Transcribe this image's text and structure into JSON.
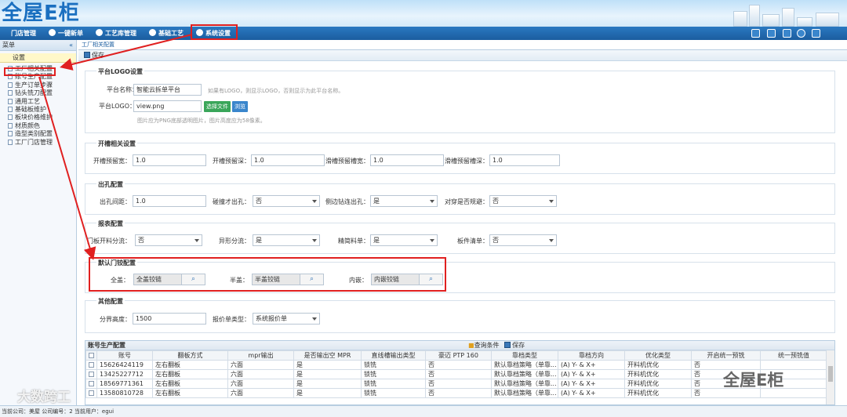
{
  "app": {
    "logo_text": "全屋E柜"
  },
  "nav": {
    "items": [
      {
        "label": "门店管理"
      },
      {
        "label": "一键新单"
      },
      {
        "label": "工艺库管理"
      },
      {
        "label": "基础工艺"
      },
      {
        "label": "系统设置"
      }
    ]
  },
  "sidebar": {
    "header": "菜单",
    "collapse": "«",
    "group": "设置",
    "items": [
      {
        "label": "工厂相关配置"
      },
      {
        "label": "账号生产配置"
      },
      {
        "label": "生产订单步骤"
      },
      {
        "label": "钻头铣刀配置"
      },
      {
        "label": "通用工艺"
      },
      {
        "label": "基础板维护"
      },
      {
        "label": "板块价格维护"
      },
      {
        "label": "材质颜色"
      },
      {
        "label": "造型类别配置"
      },
      {
        "label": "工厂门店管理"
      }
    ]
  },
  "main": {
    "breadcrumb": "工厂相关配置",
    "save_label": "保存",
    "platform": {
      "legend": "平台LOGO设置",
      "name_label": "平台名称：",
      "name_value": "智能云拆单平台",
      "name_hint": "如果有LOGO，则显示LOGO，否则显示为此平台名称。",
      "logo_label": "平台LOGO：",
      "logo_value": "view.png",
      "choose_btn": "选择文件",
      "browse_btn": "浏览",
      "logo_hint": "图片应为PNG底部透明图片，图片高度应为58像素。"
    },
    "slot": {
      "legend": "开槽相关设置",
      "fields": [
        {
          "label": "开槽预留宽：",
          "value": "1.0"
        },
        {
          "label": "开槽预留深：",
          "value": "1.0"
        },
        {
          "label": "滑槽预留槽宽：",
          "value": "1.0"
        },
        {
          "label": "滑槽预留槽深：",
          "value": "1.0"
        }
      ]
    },
    "hole": {
      "legend": "出孔配置",
      "fields": [
        {
          "label": "出孔间距：",
          "value": "1.0"
        },
        {
          "label": "碰撞才出孔：",
          "value": "否"
        },
        {
          "label": "侧边钻连出孔：",
          "value": "是"
        },
        {
          "label": "对穿是否规避：",
          "value": "否"
        }
      ]
    },
    "report": {
      "legend": "报表配置",
      "fields": [
        {
          "label": "门板开料分流：",
          "value": "否"
        },
        {
          "label": "异形分流：",
          "value": "是"
        },
        {
          "label": "精简料单：",
          "value": "是"
        },
        {
          "label": "板件清单：",
          "value": "否"
        }
      ]
    },
    "hinge": {
      "legend": "默认门铰配置",
      "fields": [
        {
          "label": "全盖：",
          "value": "全盖铰链"
        },
        {
          "label": "半盖：",
          "value": "半盖铰链"
        },
        {
          "label": "内嵌：",
          "value": "内嵌铰链"
        }
      ]
    },
    "other": {
      "legend": "其他配置",
      "height_label": "分界高度：",
      "height_value": "1500",
      "quote_label": "报价单类型：",
      "quote_value": "系统报价单"
    },
    "grid": {
      "title": "账号生产配置",
      "query_label": "查询条件",
      "save_label": "保存",
      "columns": [
        "账号",
        "翻板方式",
        "mpr输出",
        "是否输出空 MPR",
        "直线槽输出类型",
        "豪迈 PTP 160",
        "靠档类型",
        "靠档方向",
        "优化类型",
        "开启统一预铣",
        "统一预铣值"
      ],
      "rows": [
        [
          "15626424119",
          "左右翻板",
          "六面",
          "是",
          "锁铣",
          "否",
          "默认靠档策略（单靠...",
          "(A) Y- & X+",
          "开料机优化",
          "否",
          ""
        ],
        [
          "13425227712",
          "左右翻板",
          "六面",
          "是",
          "锁铣",
          "否",
          "默认靠档策略（单靠...",
          "(A) Y- & X+",
          "开料机优化",
          "否",
          ""
        ],
        [
          "18569771361",
          "左右翻板",
          "六面",
          "是",
          "锁铣",
          "否",
          "默认靠档策略（单靠...",
          "(A) Y- & X+",
          "开料机优化",
          "否",
          ""
        ],
        [
          "13580810728",
          "左右翻板",
          "六面",
          "是",
          "锁铣",
          "否",
          "默认靠档策略（单靠...",
          "(A) Y- & X+",
          "开料机优化",
          "否",
          ""
        ]
      ]
    }
  },
  "status": {
    "text": "当前公司：美屋    公司编号：2    当前用户：egui"
  },
  "watermarks": {
    "left": "大数跨工",
    "right": "全屋E柜"
  },
  "colors": {
    "nav": "#1b5d9f",
    "highlight": "#e02020",
    "green_btn": "#3aa65a"
  }
}
